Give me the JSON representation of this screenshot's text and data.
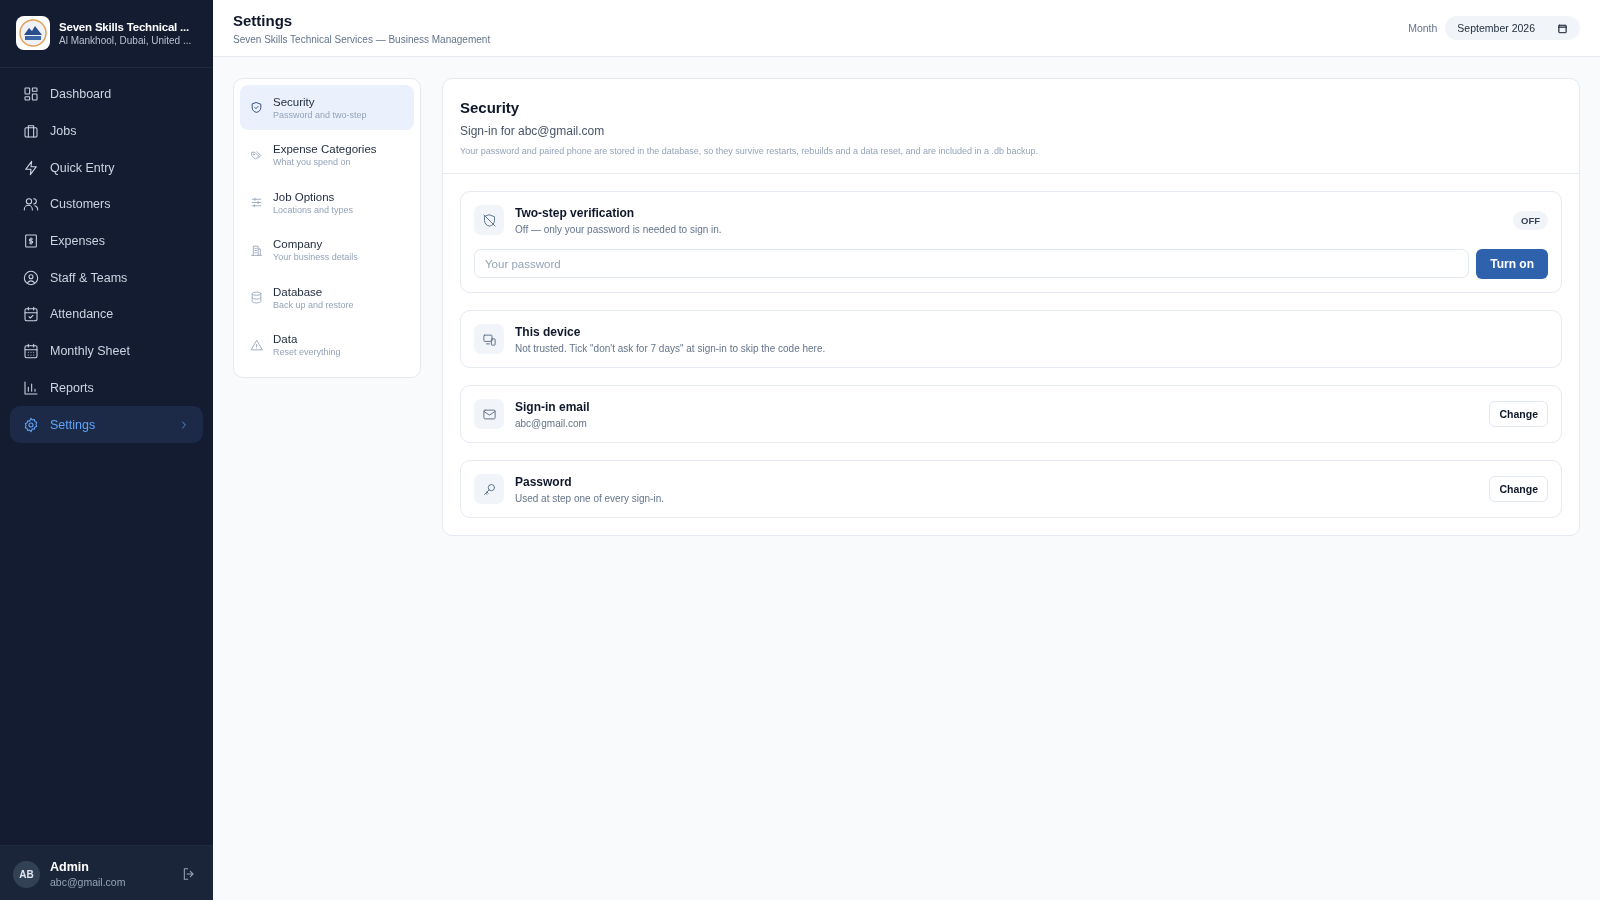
{
  "company": {
    "name": "Seven Skills Technical ...",
    "location": "Al Mankhool, Dubai, United ..."
  },
  "sidebar": {
    "items": [
      {
        "label": "Dashboard",
        "selected": false
      },
      {
        "label": "Jobs",
        "selected": false
      },
      {
        "label": "Quick Entry",
        "selected": false
      },
      {
        "label": "Customers",
        "selected": false
      },
      {
        "label": "Expenses",
        "selected": false
      },
      {
        "label": "Staff & Teams",
        "selected": false
      },
      {
        "label": "Attendance",
        "selected": false
      },
      {
        "label": "Monthly Sheet",
        "selected": false
      },
      {
        "label": "Reports",
        "selected": false
      },
      {
        "label": "Settings",
        "selected": true
      }
    ]
  },
  "user": {
    "initials": "AB",
    "name": "Admin",
    "email": "abc@gmail.com"
  },
  "header": {
    "title": "Settings",
    "subtitle": "Seven Skills Technical Services — Business Management",
    "month_label": "Month",
    "month_value": "September 2026"
  },
  "settings_nav": [
    {
      "title": "Security",
      "subtitle": "Password and two-step",
      "selected": true
    },
    {
      "title": "Expense Categories",
      "subtitle": "What you spend on",
      "selected": false
    },
    {
      "title": "Job Options",
      "subtitle": "Locations and types",
      "selected": false
    },
    {
      "title": "Company",
      "subtitle": "Your business details",
      "selected": false
    },
    {
      "title": "Database",
      "subtitle": "Back up and restore",
      "selected": false
    },
    {
      "title": "Data",
      "subtitle": "Reset everything",
      "selected": false
    }
  ],
  "panel": {
    "title": "Security",
    "subtitle": "Sign-in for abc@gmail.com",
    "note": "Your password and paired phone are stored in the database, so they survive restarts, rebuilds and a data reset, and are included in a .db backup."
  },
  "cards": [
    {
      "kind": "toggle",
      "title": "Two-step verification",
      "subtitle": "Off — only your password is needed to sign in.",
      "badge": "OFF",
      "placeholder": "Your password",
      "button": "Turn on"
    },
    {
      "kind": "info",
      "title": "This device",
      "subtitle": "Not trusted. Tick \"don't ask for 7 days\" at sign-in to skip the code here."
    },
    {
      "kind": "action",
      "title": "Sign-in email",
      "subtitle": "abc@gmail.com",
      "button": "Change"
    },
    {
      "kind": "action",
      "title": "Password",
      "subtitle": "Used at step one of every sign-in.",
      "button": "Change"
    }
  ]
}
